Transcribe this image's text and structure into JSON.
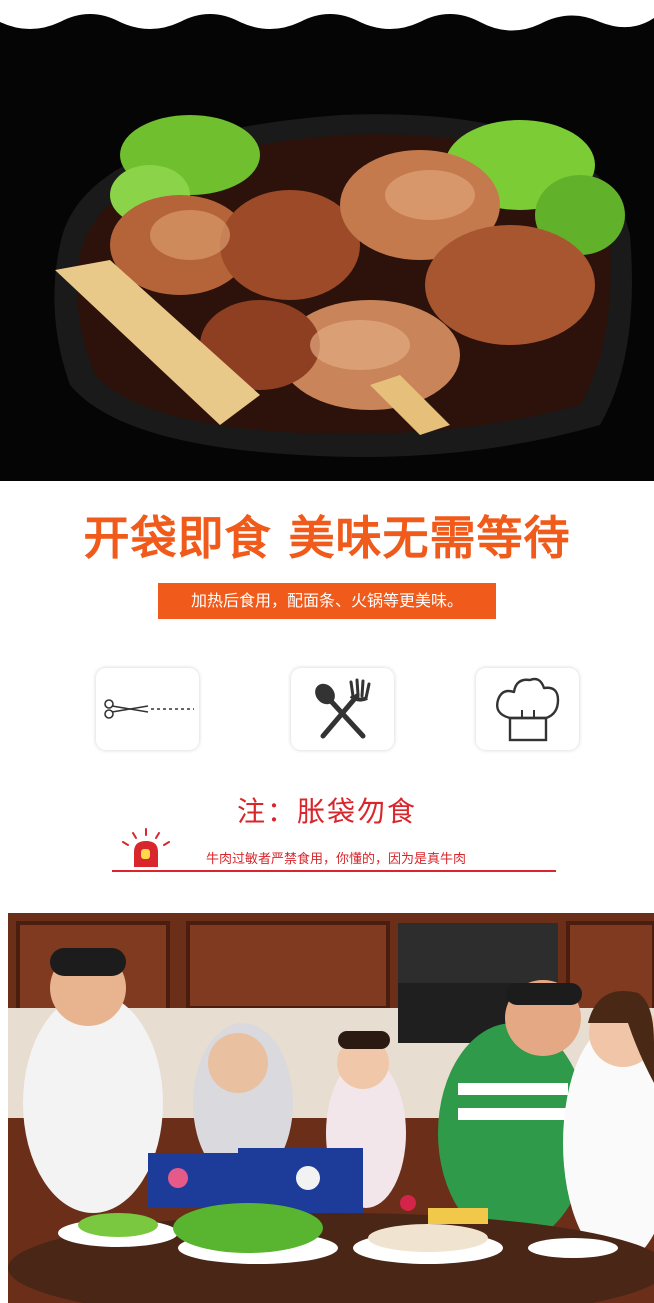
{
  "headline": "开袋即食 美味无需等待",
  "subtitle": "加热后食用，配面条、火锅等更美味。",
  "icons": [
    "scissors-icon",
    "fork-spoon-icon",
    "chef-hat-icon"
  ],
  "warning": {
    "title": "注：胀袋勿食",
    "note": "牛肉过敏者严禁食用，你懂的，因为是真牛肉"
  },
  "colors": {
    "accent": "#f05a1a",
    "warning": "#d8262c"
  }
}
